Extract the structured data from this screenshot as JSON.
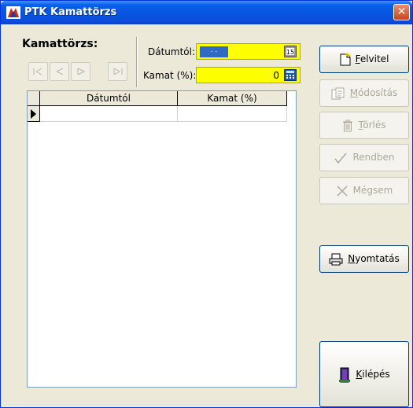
{
  "window": {
    "title": "PTK Kamattörzs",
    "close_symbol": "✕"
  },
  "form": {
    "heading": "Kamattörzs:",
    "date_label": "Dátumtól:",
    "date_value": ". .",
    "rate_label": "Kamat (%):",
    "rate_value": "0"
  },
  "nav": [
    "first-record-icon",
    "prev-record-icon",
    "next-record-icon",
    "last-record-icon"
  ],
  "grid": {
    "columns": [
      "Dátumtól",
      "Kamat (%)"
    ],
    "rows": []
  },
  "buttons": {
    "add": {
      "label_pre": "",
      "label_u": "F",
      "label_post": "elvitel"
    },
    "edit": {
      "label_pre": "",
      "label_u": "M",
      "label_post": "ódosítás"
    },
    "delete": {
      "label_pre": "",
      "label_u": "T",
      "label_post": "örlés"
    },
    "ok": {
      "label": "Rendben"
    },
    "cancel": {
      "label": "Mégsem"
    },
    "print": {
      "label_pre": "",
      "label_u": "N",
      "label_post": "yomtatás"
    },
    "exit": {
      "label_pre": "",
      "label_u": "K",
      "label_post": "ilépés"
    }
  },
  "colors": {
    "field_bg": "#ffff00",
    "selection": "#316ac5",
    "title_blue": "#0854e0"
  }
}
